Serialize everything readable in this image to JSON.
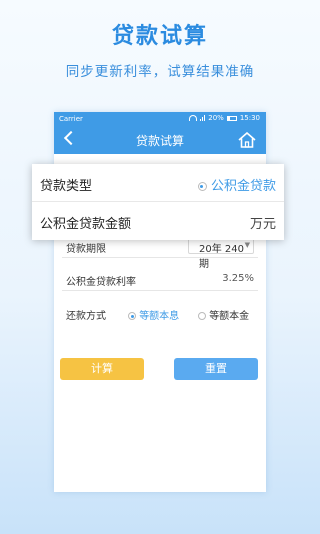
{
  "promo": {
    "title": "贷款试算",
    "subtitle": "同步更新利率，试算结果准确"
  },
  "status_bar": {
    "carrier": "Carrier",
    "battery": "20%",
    "time": "15:30"
  },
  "nav": {
    "title": "贷款试算",
    "back_icon": "chevron-left-icon",
    "home_icon": "home-icon"
  },
  "loan_type": {
    "label": "贷款类型",
    "selected": "公积金贷款"
  },
  "loan_amount": {
    "label": "公积金贷款金额",
    "unit": "万元"
  },
  "loan_term": {
    "label": "贷款期限",
    "selected": "20年 240期"
  },
  "loan_rate": {
    "label": "公积金贷款利率",
    "value": "3.25%"
  },
  "repayment": {
    "label": "还款方式",
    "options": [
      "等额本息",
      "等额本金"
    ],
    "selected": "等额本息"
  },
  "buttons": {
    "calculate": "计算",
    "reset": "重置"
  },
  "colors": {
    "primary": "#3f9be6",
    "calc_button": "#f6c343",
    "reset_button": "#5aaaf0"
  }
}
